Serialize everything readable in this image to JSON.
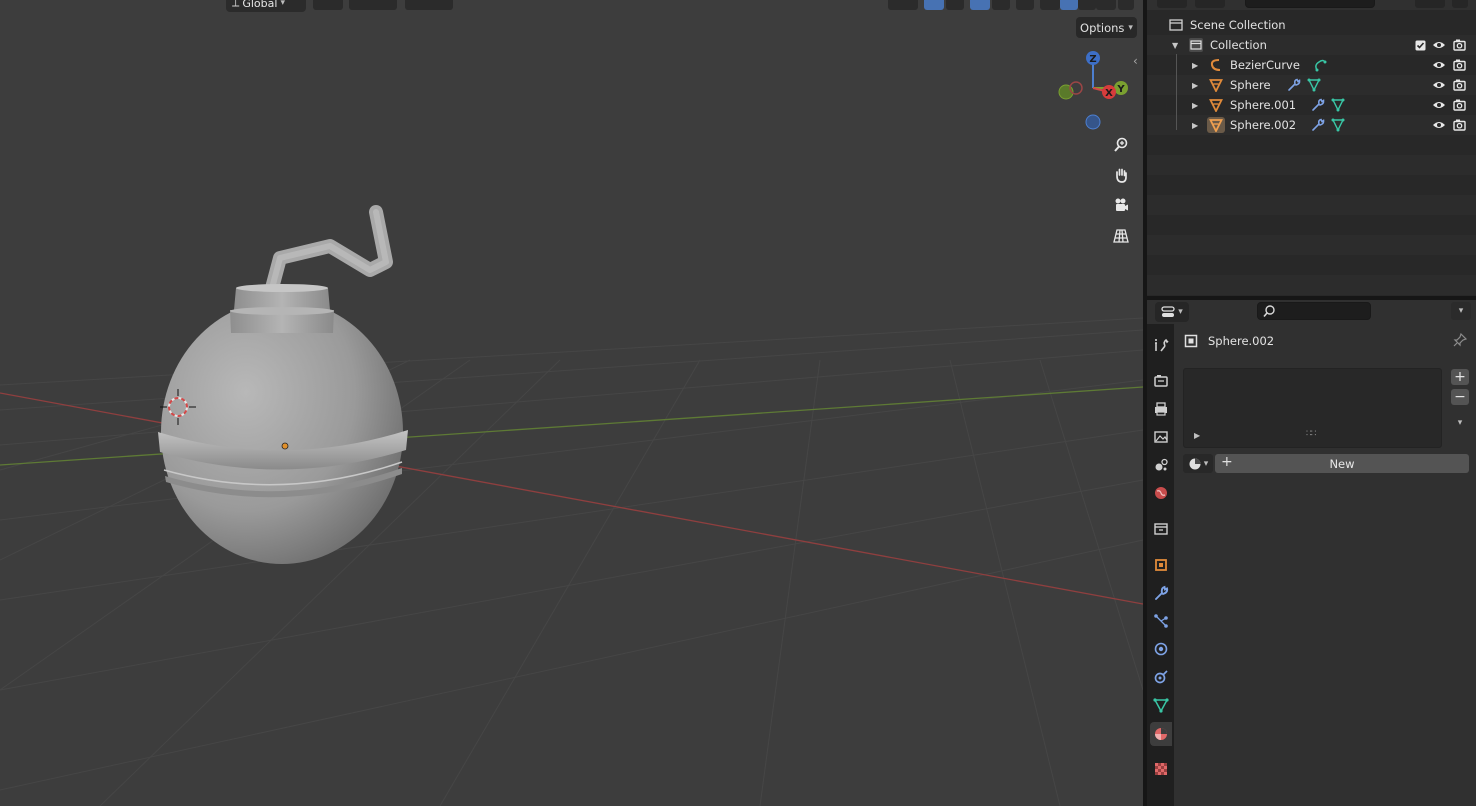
{
  "viewport": {
    "header": {
      "orientation_label": "Global",
      "options_label": "Options"
    },
    "gizmo": {
      "axis_z": "Z",
      "axis_y": "Y",
      "axis_x": "X"
    },
    "nav_tools": [
      "zoom-icon",
      "hand-pan-icon",
      "camera-icon",
      "grid-perspective-icon"
    ],
    "colors": {
      "background": "#3d3d3d",
      "x_axis": "#9b4141",
      "y_axis": "#6b8a3a",
      "selection_origin": "#e08a2c"
    }
  },
  "outliner": {
    "scene_collection_label": "Scene Collection",
    "collection_label": "Collection",
    "items": [
      {
        "label": "BezierCurve",
        "type": "curve",
        "icons": [
          "curve-data-icon"
        ]
      },
      {
        "label": "Sphere",
        "type": "mesh",
        "icons": [
          "modifier-wrench-icon",
          "mesh-data-icon"
        ]
      },
      {
        "label": "Sphere.001",
        "type": "mesh",
        "icons": [
          "modifier-wrench-icon",
          "mesh-data-icon"
        ]
      },
      {
        "label": "Sphere.002",
        "type": "mesh",
        "selected": true,
        "icons": [
          "modifier-wrench-icon",
          "mesh-data-icon"
        ]
      }
    ]
  },
  "properties": {
    "object_name": "Sphere.002",
    "new_button_label": "New",
    "tabs": [
      "tool",
      "render",
      "output",
      "view-layer",
      "scene",
      "world",
      "collection",
      "object",
      "modifiers",
      "particles",
      "physics",
      "constraints",
      "data",
      "material",
      "texture"
    ],
    "active_tab": "material",
    "colors": {
      "accent_blue": "#4772b3",
      "material_tab": "#e06868"
    }
  }
}
